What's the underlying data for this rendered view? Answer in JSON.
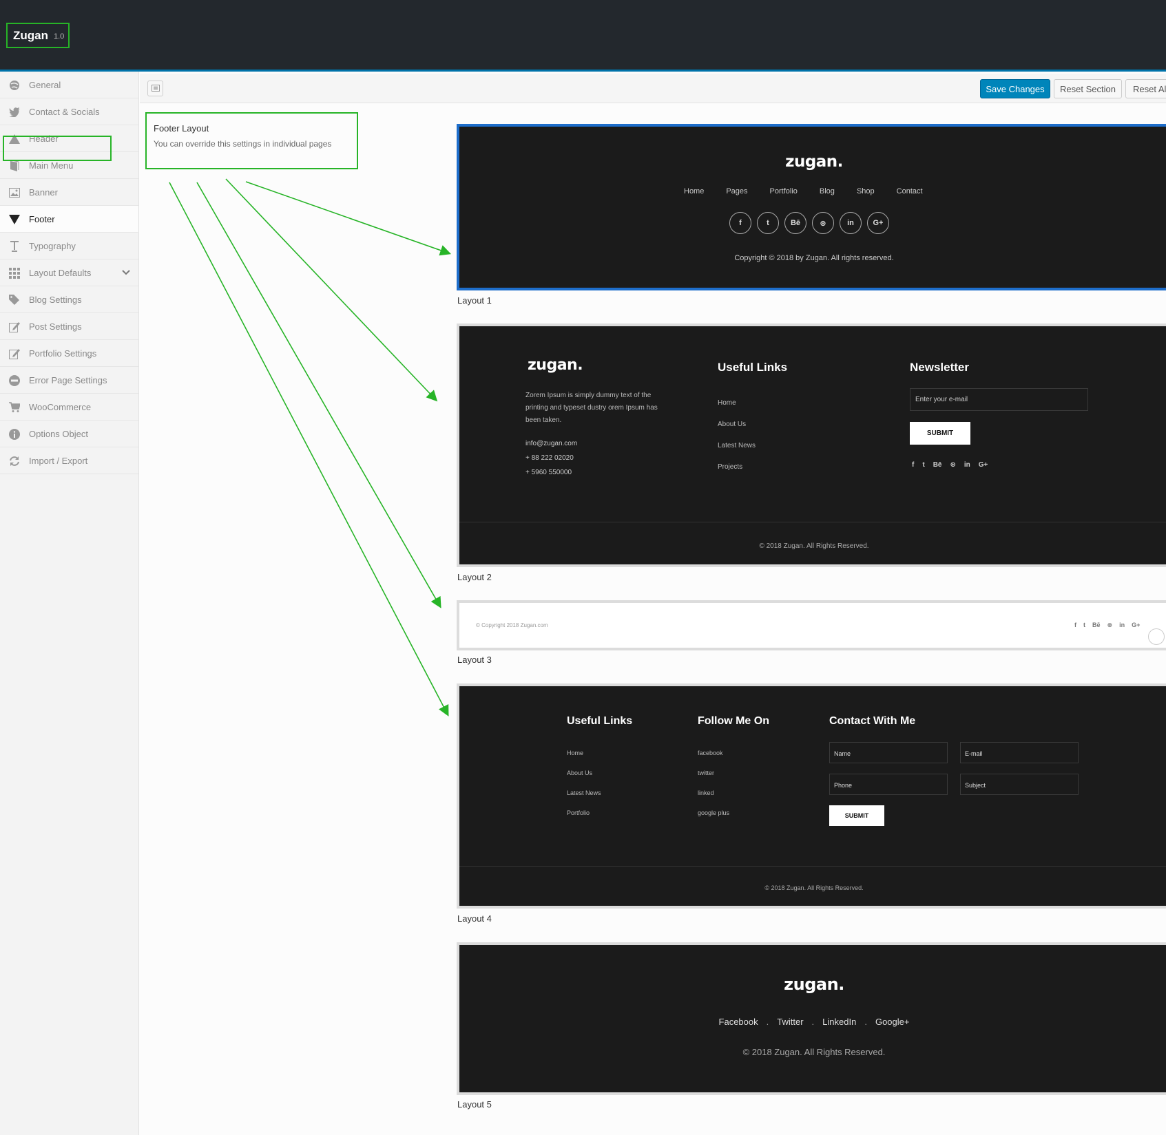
{
  "brand": {
    "name": "Zugan",
    "version": "1.0"
  },
  "sidebar": {
    "items": [
      {
        "label": "General",
        "icon": "globe-icon"
      },
      {
        "label": "Contact & Socials",
        "icon": "twitter-icon"
      },
      {
        "label": "Header",
        "icon": "triangle-up-icon"
      },
      {
        "label": "Main Menu",
        "icon": "book-icon"
      },
      {
        "label": "Banner",
        "icon": "image-icon"
      },
      {
        "label": "Footer",
        "icon": "triangle-down-icon",
        "active": true
      },
      {
        "label": "Typography",
        "icon": "text-icon"
      },
      {
        "label": "Layout Defaults",
        "icon": "grid-icon",
        "expandable": true
      },
      {
        "label": "Blog Settings",
        "icon": "tags-icon"
      },
      {
        "label": "Post Settings",
        "icon": "edit-icon"
      },
      {
        "label": "Portfolio Settings",
        "icon": "edit-icon"
      },
      {
        "label": "Error Page Settings",
        "icon": "minus-circle-icon"
      },
      {
        "label": "WooCommerce",
        "icon": "cart-icon"
      },
      {
        "label": "Options Object",
        "icon": "info-icon"
      },
      {
        "label": "Import / Export",
        "icon": "refresh-icon"
      }
    ]
  },
  "toolbar": {
    "save": "Save Changes",
    "reset_section": "Reset Section",
    "reset_all": "Reset All"
  },
  "option": {
    "title": "Footer Layout",
    "description": "You can override this settings in individual pages"
  },
  "layouts": {
    "captions": [
      "Layout 1",
      "Layout 2",
      "Layout 3",
      "Layout 4",
      "Layout 5"
    ],
    "selected_index": 1,
    "l1": {
      "logo": "zugan.",
      "nav": [
        "Home",
        "Pages",
        "Portfolio",
        "Blog",
        "Shop",
        "Contact"
      ],
      "socials": [
        "f",
        "t",
        "Bē",
        "⊛",
        "in",
        "G+"
      ],
      "copyright": "Copyright © 2018 by Zugan. All rights reserved."
    },
    "l2": {
      "logo": "zugan.",
      "about": "Zorem Ipsum is simply dummy text of the printing and typeset dustry orem Ipsum has been taken.",
      "email": "info@zugan.com",
      "phone1": "+ 88 222 02020",
      "phone2": "+ 5960 550000",
      "links_title": "Useful Links",
      "links": [
        "Home",
        "About Us",
        "Latest News",
        "Projects"
      ],
      "newsletter_title": "Newsletter",
      "newsletter_placeholder": "Enter your e-mail",
      "submit": "SUBMIT",
      "socials": [
        "f",
        "t",
        "Bē",
        "⊛",
        "in",
        "G+"
      ],
      "copyright": "© 2018 Zugan. All Rights Reserved."
    },
    "l3": {
      "copyright": "© Copyright 2018 Zugan.com",
      "socials": [
        "f",
        "t",
        "Bē",
        "⊛",
        "in",
        "G+"
      ]
    },
    "l4": {
      "links_title": "Useful Links",
      "links": [
        "Home",
        "About Us",
        "Latest News",
        "Portfolio"
      ],
      "follow_title": "Follow Me On",
      "follow": [
        "facebook",
        "twitter",
        "linked",
        "google plus"
      ],
      "contact_title": "Contact With Me",
      "name": "Name",
      "email": "E-mail",
      "phone": "Phone",
      "subject": "Subject",
      "submit": "SUBMIT",
      "copyright": "© 2018 Zugan. All Rights Reserved."
    },
    "l5": {
      "logo": "zugan.",
      "links": [
        "Facebook",
        "Twitter",
        "LinkedIn",
        "Google+"
      ],
      "separator": ".",
      "copyright": "© 2018 Zugan. All Rights Reserved."
    }
  },
  "colors": {
    "topbar": "#23282d",
    "accent": "#0085ba",
    "highlight": "#27b427",
    "preview_bg": "#1b1b1b",
    "selected_border": "#1e6ecb"
  }
}
